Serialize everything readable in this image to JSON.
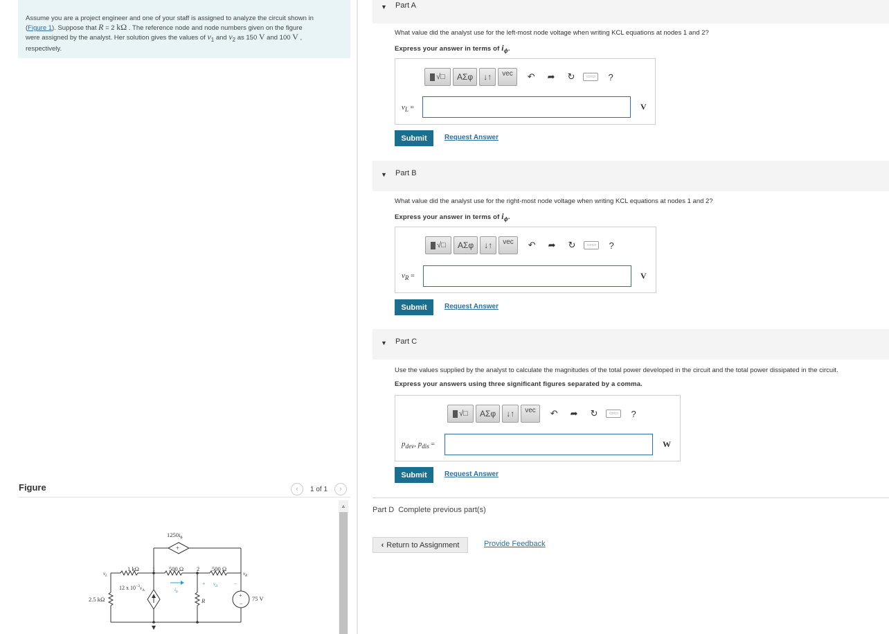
{
  "problem": {
    "line1": "Assume you are a project engineer and one of your staff is assigned to analyze the circuit shown in",
    "figure_link": "Figure 1",
    "line2_pre": "). Suppose that ",
    "R_sym": "R",
    "R_val": " = 2  ",
    "R_unit": "kΩ",
    "line2_post": " . The reference node and node numbers given on the figure",
    "line3_pre": "were assigned by the analyst. Her solution gives the values of ",
    "v1": "v",
    "v1_sub": "1",
    "and": " and ",
    "v2": "v",
    "v2_sub": "2",
    "as": " as 150  ",
    "V1": "V",
    "and2": " and 100  ",
    "V2": "V",
    "comma": " ,",
    "line4": "respectively."
  },
  "figure": {
    "title": "Figure",
    "count": "1 of 1",
    "prev_icon": "chevron-left-icon",
    "next_icon": "chevron-right-icon"
  },
  "circuit": {
    "dep_v_src": "1250i",
    "dep_v_sub": "ϕ",
    "r1k": "1 kΩ",
    "node1": "1",
    "r500a": "500 Ω",
    "node2": "2",
    "r500b": "500 Ω",
    "vL": "v",
    "vL_sub": "L",
    "vR": "v",
    "vR_sub": "R",
    "dep_i_src": "12 x 10",
    "dep_i_exp": "−3",
    "dep_i_var": "v",
    "dep_i_sub": "Δ",
    "i_phi": "i",
    "i_phi_sub": "ϕ",
    "v_delta": "v",
    "v_delta_sub": "Δ",
    "plus": "+",
    "minus": "−",
    "r25k": "2.5 kΩ",
    "R": "R",
    "src75": "75 V"
  },
  "parts": [
    {
      "title": "Part A",
      "question": "What value did the analyst use for the left-most node voltage when writing KCL equations at nodes 1 and 2?",
      "instr_pre": "Express your answer in terms of ",
      "instr_var": "i",
      "instr_sub": "ϕ",
      "instr_post": ".",
      "label": "v",
      "label_sub": "L",
      "eq": " =",
      "unit": "V",
      "submit": "Submit",
      "request": "Request Answer"
    },
    {
      "title": "Part B",
      "question": "What value did the analyst use for the right-most node voltage when writing KCL equations at nodes 1 and 2?",
      "instr_pre": "Express your answer in terms of ",
      "instr_var": "i",
      "instr_sub": "ϕ",
      "instr_post": ".",
      "label": "v",
      "label_sub": "R",
      "eq": " =",
      "unit": "V",
      "submit": "Submit",
      "request": "Request Answer"
    },
    {
      "title": "Part C",
      "question": "Use the values supplied by the analyst to calculate the magnitudes of the total power developed in the circuit and the total power dissipated in the circuit.",
      "instr_pre": "Express your answers using three significant figures separated by a comma.",
      "label": "p",
      "label_sub": "dev",
      "label2": ", p",
      "label2_sub": "dis",
      "eq": " =",
      "unit": "W",
      "submit": "Submit",
      "request": "Request Answer"
    }
  ],
  "toolbar": {
    "template": "√",
    "greek": "ΑΣφ",
    "arrows": "↓↑",
    "vec": "vec",
    "undo_icon": "undo-icon",
    "redo_icon": "redo-icon",
    "reset_icon": "reset-icon",
    "keyboard_icon": "keyboard-icon",
    "help": "?"
  },
  "partD": {
    "title": "Part D",
    "status": "Complete previous part(s)"
  },
  "footer": {
    "return": "Return to Assignment",
    "feedback": "Provide Feedback"
  }
}
